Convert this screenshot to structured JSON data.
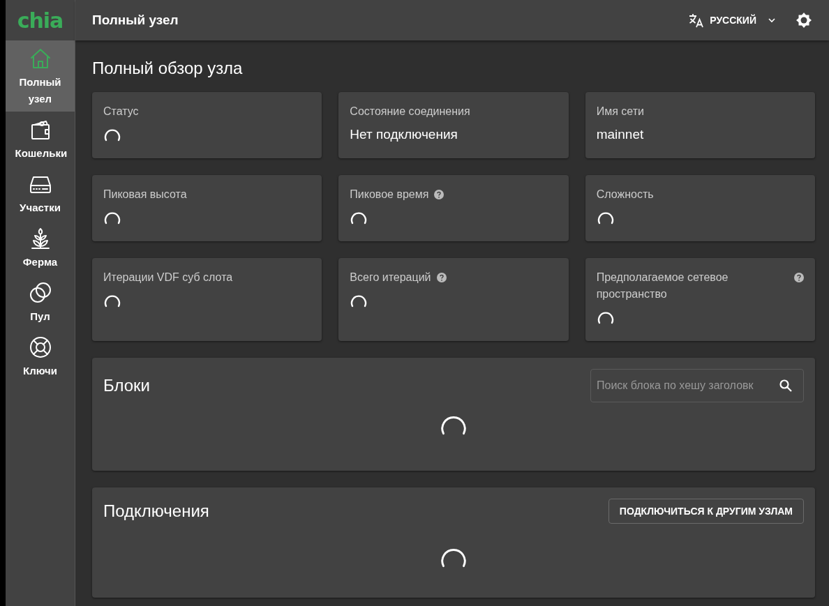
{
  "logo": "chia",
  "header": {
    "title": "Полный узел",
    "language": "РУССКИЙ"
  },
  "sidebar": {
    "items": [
      {
        "label": "Полный узел",
        "selected": true
      },
      {
        "label": "Кошельки",
        "selected": false
      },
      {
        "label": "Участки",
        "selected": false
      },
      {
        "label": "Ферма",
        "selected": false
      },
      {
        "label": "Пул",
        "selected": false
      },
      {
        "label": "Ключи",
        "selected": false
      }
    ]
  },
  "page_title": "Полный обзор узла",
  "stats": [
    {
      "label": "Статус",
      "kind": "loading",
      "help": false
    },
    {
      "label": "Состояние соединения",
      "kind": "value",
      "value": "Нет подключения",
      "help": false
    },
    {
      "label": "Имя сети",
      "kind": "value",
      "value": "mainnet",
      "help": false
    },
    {
      "label": "Пиковая высота",
      "kind": "loading",
      "help": false
    },
    {
      "label": "Пиковое время",
      "kind": "loading",
      "help": true
    },
    {
      "label": "Сложность",
      "kind": "loading",
      "help": false
    },
    {
      "label": "Итерации VDF суб слота",
      "kind": "loading",
      "help": false
    },
    {
      "label": "Всего итераций",
      "kind": "loading",
      "help": true
    },
    {
      "label": "Предполагаемое сетевое пространство",
      "kind": "loading",
      "help": true
    }
  ],
  "blocks": {
    "title": "Блоки",
    "search": {
      "placeholder": "Поиск блока по хешу заголовк"
    },
    "loading": true
  },
  "connections": {
    "title": "Подключения",
    "button": "ПОДКЛЮЧИТЬСЯ К ДРУГИМ УЗЛАМ",
    "loading": true
  }
}
